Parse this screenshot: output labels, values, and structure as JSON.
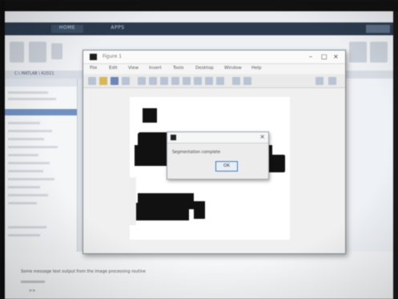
{
  "matlab": {
    "tabs": [
      "HOME",
      "APPS"
    ],
    "path_text": "C:\\ MATLAB \\ R2021",
    "command_line_1": "Some message text output from the image processing routine",
    "command_line_2": ">>"
  },
  "figure": {
    "title": "Figure 1",
    "axes_title": "",
    "menus": [
      "File",
      "Edit",
      "View",
      "Insert",
      "Tools",
      "Desktop",
      "Window",
      "Help"
    ],
    "toolbar_icons": [
      "new-icon",
      "open-icon",
      "save-icon",
      "print-icon",
      "pointer-icon",
      "zoom-in-icon",
      "zoom-out-icon",
      "pan-icon",
      "rotate-icon",
      "datacursor-icon",
      "brush-icon",
      "link-icon",
      "colorbar-icon",
      "legend-icon",
      "hide-tools-icon",
      "show-tools-icon"
    ]
  },
  "dialog": {
    "title": "",
    "message": "Segmentation complete",
    "ok_label": "OK"
  },
  "colors": {
    "accent": "#3e78c4",
    "tabbar": "#2b3a4d"
  }
}
